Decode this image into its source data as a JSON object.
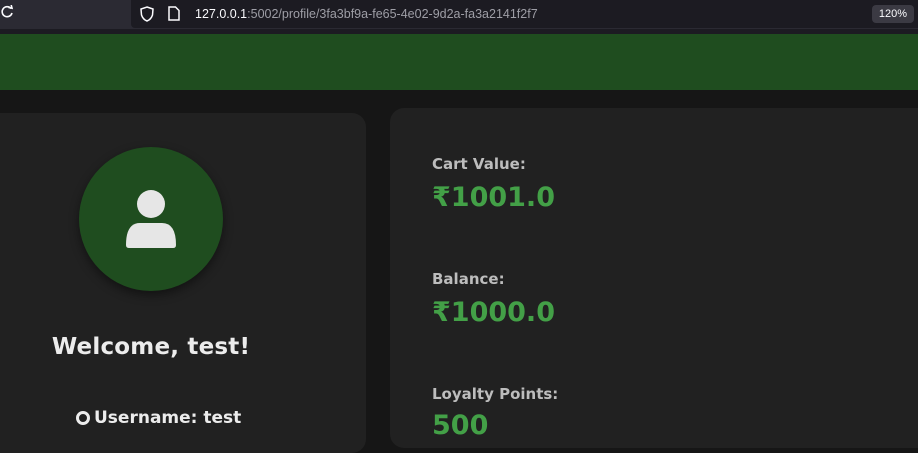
{
  "browser": {
    "url_host": "127.0.0.1",
    "url_rest": ":5002/profile/3fa3bf9a-fe65-4e02-9d2a-fa3a2141f2f7",
    "zoom": "120%"
  },
  "profile": {
    "welcome": "Welcome, test!",
    "username_text": "Username: test"
  },
  "stats": {
    "cart_label": "Cart Value:",
    "cart_value": "₹1001.0",
    "balance_label": "Balance:",
    "balance_value": "₹1000.0",
    "loyalty_label": "Loyalty Points:",
    "loyalty_value": "500"
  },
  "colors": {
    "brand_green": "#1f4d1f",
    "value_green": "#43a047",
    "card_bg": "#212121",
    "page_bg": "#161616"
  },
  "icons": [
    "reload-icon",
    "shield-icon",
    "page-icon",
    "user-icon",
    "location-pin-icon"
  ]
}
